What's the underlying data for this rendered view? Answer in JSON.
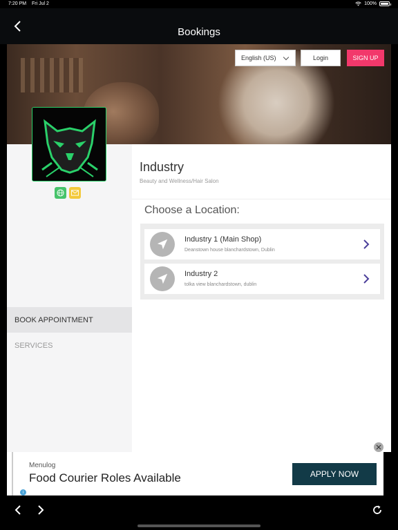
{
  "status_bar": {
    "time": "7:20 PM",
    "date": "Fri Jul 2",
    "battery": "100%"
  },
  "nav": {
    "title": "Bookings"
  },
  "header": {
    "language": "English (US)",
    "login": "Login",
    "signup": "SIGN UP"
  },
  "business": {
    "name": "Industry",
    "category": "Beauty and Wellness/Hair Salon"
  },
  "sidebar": {
    "items": [
      {
        "label": "BOOK APPOINTMENT",
        "active": true
      },
      {
        "label": "SERVICES",
        "active": false
      }
    ]
  },
  "main": {
    "heading": "Choose a Location:",
    "locations": [
      {
        "name": "Industry 1 (Main Shop)",
        "address": "Deanstown house blanchardstown, Dublin"
      },
      {
        "name": "Industry 2",
        "address": "tolka view blanchardstown, dublin"
      }
    ]
  },
  "ad": {
    "brand": "Menulog",
    "headline": "Food Courier Roles Available",
    "cta": "APPLY NOW"
  },
  "colors": {
    "signup": "#f2386b",
    "cta": "#123a47",
    "logo_accent": "#2ad16a",
    "web_badge": "#46c36a",
    "mail_badge": "#f3c93b"
  }
}
